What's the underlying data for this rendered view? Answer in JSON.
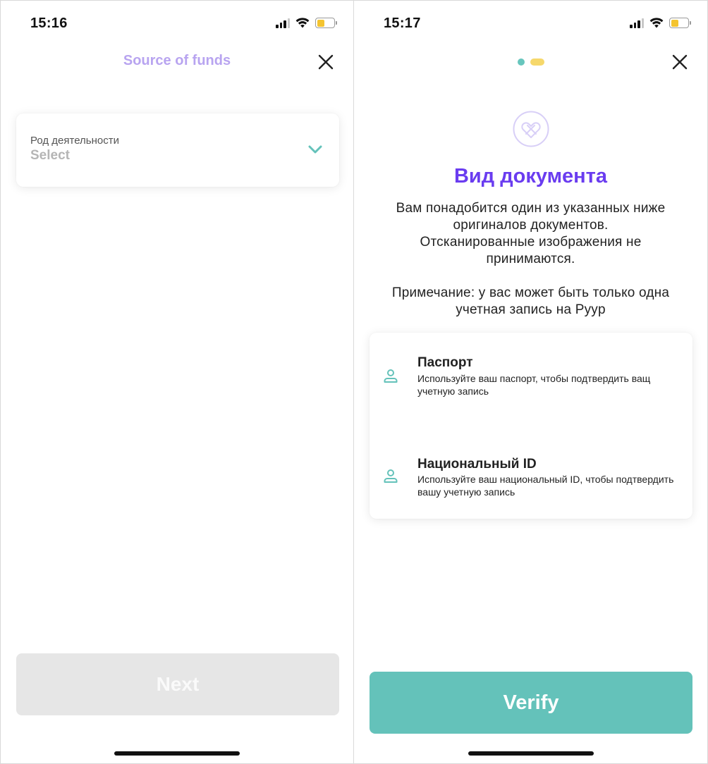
{
  "colors": {
    "header_title": "#b8a4f0",
    "accent_teal": "#64c2ba",
    "doc_title": "#6a3cf0",
    "progress_active": "#67c6bd",
    "progress_current": "#f6d86b",
    "battery_fill": "#f4c430",
    "disabled_button": "#e6e6e6"
  },
  "left_screen": {
    "status": {
      "time": "15:16",
      "battery_level": 0.45
    },
    "header": {
      "title": "Source of funds",
      "close_icon": "close-icon"
    },
    "field": {
      "label": "Род деятельности",
      "value": "Select",
      "icon": "chevron-down-icon"
    },
    "next_button": {
      "label": "Next",
      "enabled": false
    }
  },
  "right_screen": {
    "status": {
      "time": "15:17",
      "battery_level": 0.45
    },
    "header": {
      "close_icon": "close-icon",
      "progress_steps": 2,
      "current_step": 2
    },
    "logo_icon": "heart-logo-icon",
    "title": "Вид документа",
    "description": "Вам понадобится один из указанных ниже\nоригиналов документов.\nОтсканированные изображения не\nпринимаются.",
    "note": "Примечание: у вас может быть только одна\nучетная запись на Pyyp",
    "options": [
      {
        "icon": "person-icon",
        "title": "Паспорт",
        "subtitle": "Используйте ваш паспорт, чтобы подтвердить ващ учетную запись"
      },
      {
        "icon": "person-icon",
        "title": "Национальный ID",
        "subtitle": "Используйте ваш национальный ID, чтобы подтвердить вашу учетную запись"
      }
    ],
    "verify_button": {
      "label": "Verify"
    }
  }
}
